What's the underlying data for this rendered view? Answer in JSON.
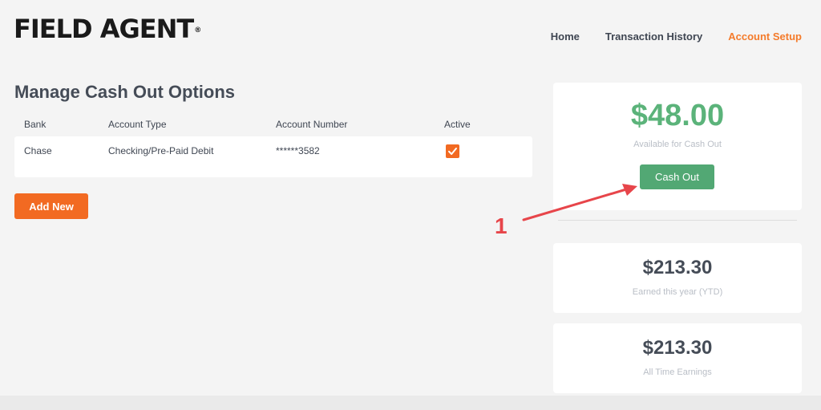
{
  "header": {
    "logo_text": "FIELD AGENT",
    "logo_mark": "®",
    "nav": [
      {
        "label": "Home"
      },
      {
        "label": "Transaction History"
      },
      {
        "label": "Account Setup",
        "active": true
      }
    ]
  },
  "cash_out_options": {
    "title": "Manage Cash Out Options",
    "columns": [
      "Bank",
      "Account Type",
      "Account Number",
      "Active"
    ],
    "rows": [
      {
        "bank": "Chase",
        "account_type": "Checking/Pre-Paid Debit",
        "account_number": "******3582",
        "active": true
      }
    ],
    "add_new_label": "Add New"
  },
  "balance": {
    "available_amount": "$48.00",
    "available_label": "Available for Cash Out",
    "cash_out_label": "Cash Out",
    "ytd_amount": "$213.30",
    "ytd_label": "Earned this year (YTD)",
    "all_time_amount": "$213.30",
    "all_time_label": "All Time Earnings"
  },
  "annotation": {
    "number": "1"
  },
  "colors": {
    "accent": "#f26a22",
    "nav_active": "#f47b2b",
    "money_green": "#5bb37a",
    "cash_out_button": "#52a874",
    "annotation": "#e7454a"
  },
  "icons": {
    "active_checkbox": "checkmark-icon",
    "annotation_arrow": "arrow-icon"
  }
}
